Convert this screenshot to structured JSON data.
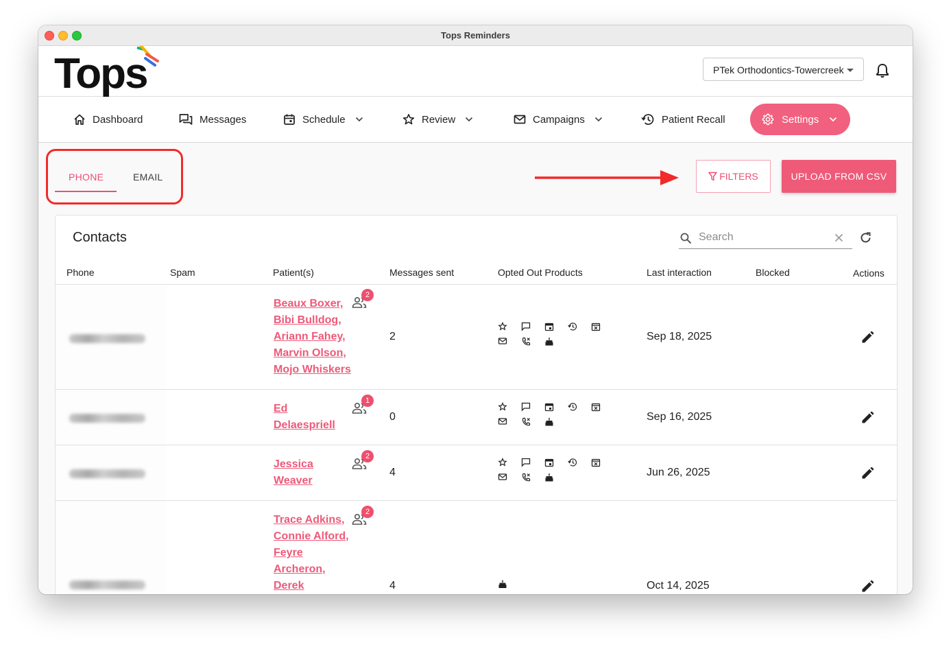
{
  "window": {
    "title": "Tops Reminders"
  },
  "header": {
    "logo_text": "Tops",
    "org_select": "PTek Orthodontics-Towercreek"
  },
  "nav": {
    "dashboard": "Dashboard",
    "messages": "Messages",
    "schedule": "Schedule",
    "review": "Review",
    "campaigns": "Campaigns",
    "patient_recall": "Patient Recall",
    "settings": "Settings"
  },
  "tabs": {
    "phone": "PHONE",
    "email": "EMAIL",
    "active": "PHONE"
  },
  "actions": {
    "filters": "FILTERS",
    "upload": "UPLOAD FROM CSV"
  },
  "contacts": {
    "title": "Contacts",
    "search_placeholder": "Search",
    "columns": [
      "Phone",
      "Spam",
      "Patient(s)",
      "Messages sent",
      "Opted Out Products",
      "Last interaction",
      "Blocked",
      "Actions"
    ],
    "rows": [
      {
        "patients": [
          "Beaux Boxer,",
          "Bibi Bulldog,",
          "Ariann Fahey,",
          "Marvin Olson,",
          "Mojo Whiskers"
        ],
        "badge": "2",
        "messages_sent": "2",
        "opted_out_icons": [
          "review-star-icon",
          "messages-icon",
          "schedule-icon",
          "recall-icon",
          "calendar-x-icon",
          "email-icon",
          "phone-icon",
          "birthday-cake-icon"
        ],
        "last_interaction": "Sep 18, 2025"
      },
      {
        "patients": [
          "Ed",
          "Delaespriell"
        ],
        "badge": "1",
        "messages_sent": "0",
        "opted_out_icons": [
          "review-star-icon",
          "messages-icon",
          "schedule-icon",
          "recall-icon",
          "calendar-x-icon",
          "email-icon",
          "phone-icon",
          "birthday-cake-icon"
        ],
        "last_interaction": "Sep 16, 2025"
      },
      {
        "patients": [
          "Jessica",
          "Weaver"
        ],
        "badge": "2",
        "messages_sent": "4",
        "opted_out_icons": [
          "review-star-icon",
          "messages-icon",
          "schedule-icon",
          "recall-icon",
          "calendar-x-icon",
          "email-icon",
          "phone-icon",
          "birthday-cake-icon"
        ],
        "last_interaction": "Jun 26, 2025"
      },
      {
        "patients": [
          "Trace Adkins,",
          "Connie Alford,",
          "Feyre",
          "Archeron,",
          "Derek"
        ],
        "badge": "2",
        "messages_sent": "4",
        "opted_out_icons": [
          "birthday-cake-icon"
        ],
        "last_interaction": "Oct 14, 2025"
      }
    ]
  },
  "colors": {
    "accent": "#ec4f72",
    "settings_bg": "#f1607e",
    "upload_bg": "#ef5a79",
    "annotation_red": "#f22a2a"
  }
}
